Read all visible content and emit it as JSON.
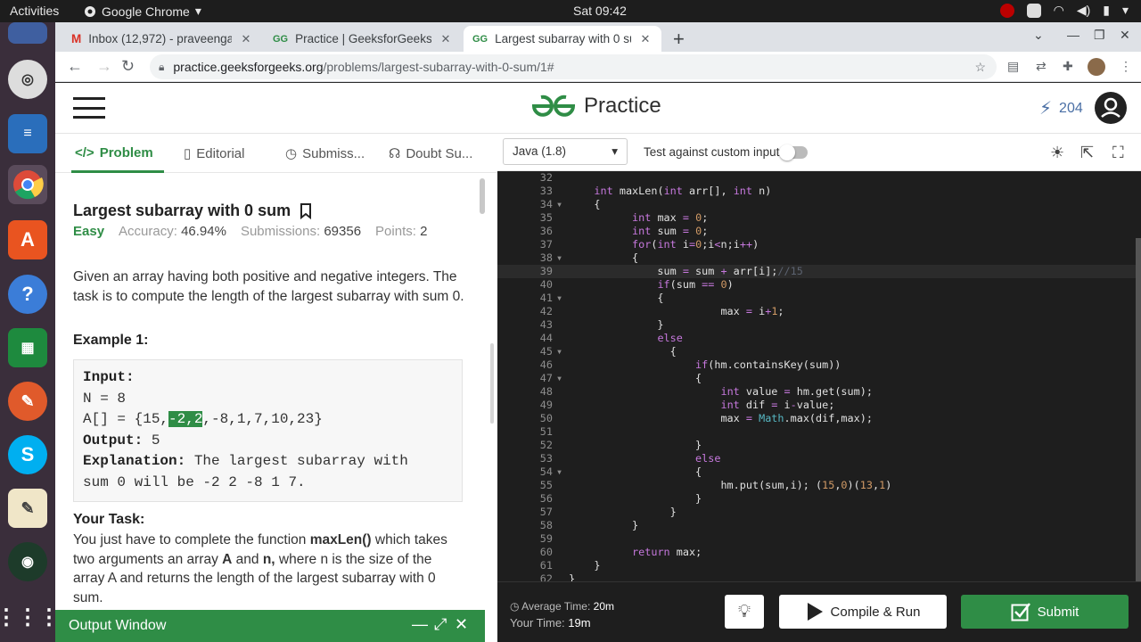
{
  "system": {
    "activities": "Activities",
    "app": "Google Chrome",
    "clock": "Sat 09:42"
  },
  "tabs": [
    {
      "title": "Inbox (12,972) - praveenga",
      "icon": "gmail-icon"
    },
    {
      "title": "Practice | GeeksforGeeks |",
      "icon": "gfg-icon"
    },
    {
      "title": "Largest subarray with 0 su",
      "icon": "gfg-icon"
    }
  ],
  "address": {
    "host": "practice.geeksforgeeks.org",
    "path": "/problems/largest-subarray-with-0-sum/1#"
  },
  "header": {
    "brand": "Practice",
    "streak": "204"
  },
  "problem_tabs": [
    "Problem",
    "Editorial",
    "Submiss...",
    "Doubt Su..."
  ],
  "problem": {
    "title": "Largest subarray with 0 sum",
    "difficulty": "Easy",
    "accuracy_label": "Accuracy:",
    "accuracy": "46.94%",
    "submissions_label": "Submissions:",
    "submissions": "69356",
    "points_label": "Points:",
    "points": "2",
    "description": "Given an array having both positive and negative integers. The task is to compute the length of the largest subarray with sum 0.",
    "example_heading": "Example 1:",
    "ex_input_label": "Input:",
    "ex_n": "N = 8",
    "ex_arr_pre": "A[] = {15,",
    "ex_arr_hl": "-2,2",
    "ex_arr_post": ",-8,1,7,10,23}",
    "ex_output_label": "Output:",
    "ex_output": "5",
    "ex_expl_label": "Explanation:",
    "ex_expl": "The largest subarray with",
    "ex_expl2": "sum 0 will be -2 2 -8 1 7.",
    "task_heading": "Your Task:",
    "task_1": "You just have to complete the function ",
    "task_fn": "maxLen()",
    "task_2": " which takes two arguments an array ",
    "task_A": "A",
    "task_3": " and ",
    "task_n": "n,",
    "task_4": " where n is the size of the array A and returns the length of the largest subarray with 0 sum."
  },
  "output_window": "Output Window",
  "editor": {
    "language": "Java (1.8)",
    "custom_input": "Test against custom input"
  },
  "code_lines": [
    {
      "n": "32",
      "f": "",
      "t": ""
    },
    {
      "n": "33",
      "f": "",
      "t": "    <span class='ty'>int</span> maxLen(<span class='ty'>int</span> arr[], <span class='ty'>int</span> n)"
    },
    {
      "n": "34",
      "f": "▾",
      "t": "    {"
    },
    {
      "n": "35",
      "f": "",
      "t": "          <span class='ty'>int</span> max <span class='op'>=</span> <span class='num'>0</span>;"
    },
    {
      "n": "36",
      "f": "",
      "t": "          <span class='ty'>int</span> sum <span class='op'>=</span> <span class='num'>0</span>;"
    },
    {
      "n": "37",
      "f": "",
      "t": "          <span class='kw'>for</span>(<span class='ty'>int</span> i<span class='op'>=</span><span class='num'>0</span>;i<span class='op'>&lt;</span>n;i<span class='op'>++</span>)"
    },
    {
      "n": "38",
      "f": "▾",
      "t": "          {"
    },
    {
      "n": "39",
      "f": "",
      "t": "              sum <span class='op'>=</span> sum <span class='op'>+</span> arr[i];<span class='cm'>//15</span>"
    },
    {
      "n": "40",
      "f": "",
      "t": "              <span class='kw'>if</span>(sum <span class='op'>==</span> <span class='num'>0</span>)"
    },
    {
      "n": "41",
      "f": "▾",
      "t": "              {"
    },
    {
      "n": "42",
      "f": "",
      "t": "                        max <span class='op'>=</span> i<span class='op'>+</span><span class='num'>1</span>;"
    },
    {
      "n": "43",
      "f": "",
      "t": "              }"
    },
    {
      "n": "44",
      "f": "",
      "t": "              <span class='kw'>else</span>"
    },
    {
      "n": "45",
      "f": "▾",
      "t": "                {"
    },
    {
      "n": "46",
      "f": "",
      "t": "                    <span class='kw'>if</span>(hm.containsKey(sum))"
    },
    {
      "n": "47",
      "f": "▾",
      "t": "                    {"
    },
    {
      "n": "48",
      "f": "",
      "t": "                        <span class='ty'>int</span> value <span class='op'>=</span> hm.get(sum);"
    },
    {
      "n": "49",
      "f": "",
      "t": "                        <span class='ty'>int</span> dif <span class='op'>=</span> i<span class='op'>-</span>value;"
    },
    {
      "n": "50",
      "f": "",
      "t": "                        max <span class='op'>=</span> <span class='cls'>Math</span>.max(dif,max);"
    },
    {
      "n": "51",
      "f": "",
      "t": ""
    },
    {
      "n": "52",
      "f": "",
      "t": "                    }"
    },
    {
      "n": "53",
      "f": "",
      "t": "                    <span class='kw'>else</span>"
    },
    {
      "n": "54",
      "f": "▾",
      "t": "                    {"
    },
    {
      "n": "55",
      "f": "",
      "t": "                        hm.put(sum,i); (<span class='num'>15</span>,<span class='num'>0</span>)(<span class='num'>13</span>,<span class='num'>1</span>)"
    },
    {
      "n": "56",
      "f": "",
      "t": "                    }"
    },
    {
      "n": "57",
      "f": "",
      "t": "                }"
    },
    {
      "n": "58",
      "f": "",
      "t": "          }"
    },
    {
      "n": "59",
      "f": "",
      "t": ""
    },
    {
      "n": "60",
      "f": "",
      "t": "          <span class='kw'>return</span> max;"
    },
    {
      "n": "61",
      "f": "",
      "t": "    }"
    },
    {
      "n": "62",
      "f": "",
      "t": "}"
    }
  ],
  "footer": {
    "avg_label": "Average Time:",
    "avg": "20m",
    "your_label": "Your Time:",
    "your": "19m",
    "run": "Compile & Run",
    "submit": "Submit"
  },
  "colors": {
    "gfg_green": "#2f8d46",
    "editor_bg": "#1e1e1e",
    "dock": "#3a2e3b"
  }
}
